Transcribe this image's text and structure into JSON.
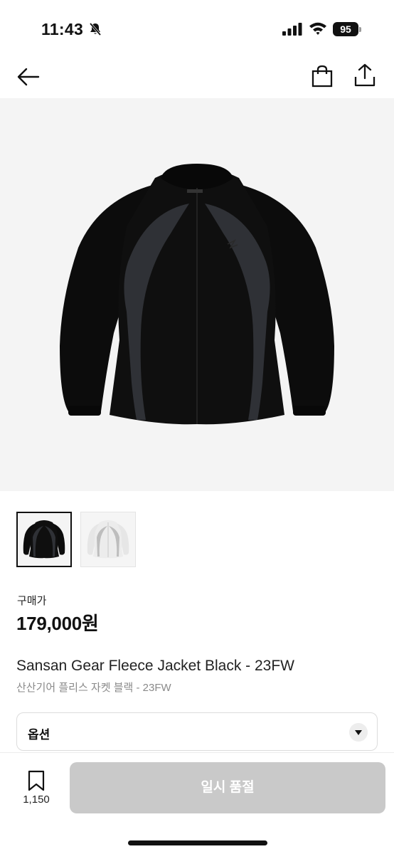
{
  "status_bar": {
    "time": "11:43",
    "battery": "95",
    "icons": [
      "bell-off-icon",
      "signal-icon",
      "wifi-icon",
      "battery-icon"
    ]
  },
  "nav": {
    "icons": [
      "back-arrow-icon",
      "shopping-bag-icon",
      "share-icon"
    ]
  },
  "product": {
    "image": "black-fleece-jacket",
    "thumbnails": [
      "black-fleece-jacket",
      "white-fleece-jacket"
    ],
    "price_label": "구매가",
    "price": "179,000원",
    "name": "Sansan Gear Fleece Jacket Black - 23FW",
    "name_ko": "산산기어 플리스 자켓 블랙 - 23FW"
  },
  "option": {
    "label": "옵션"
  },
  "bottom_bar": {
    "wish_count": "1,150",
    "buy_label": "일시 품절",
    "buy_color": "#c9c9c9"
  }
}
